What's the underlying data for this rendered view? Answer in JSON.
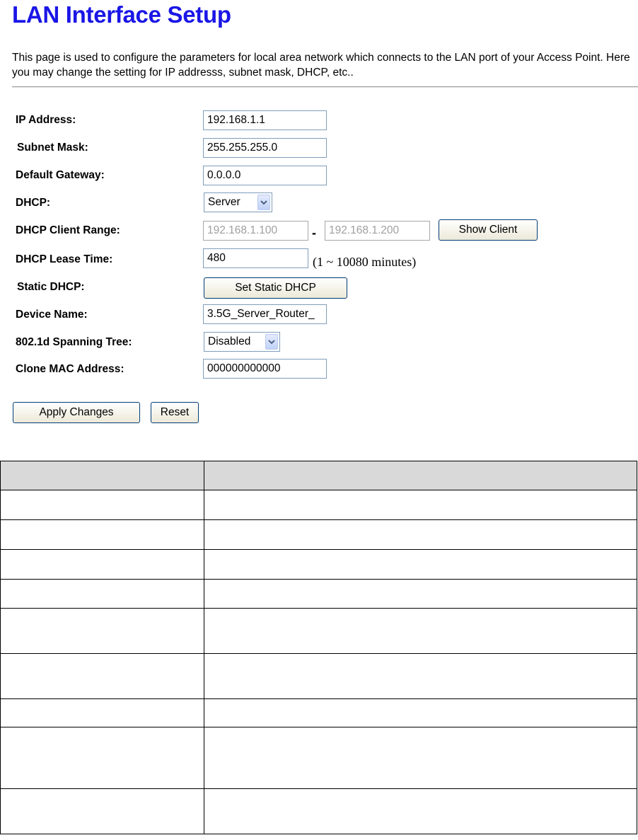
{
  "page": {
    "title": "LAN Interface Setup",
    "description": "This page is used to configure the parameters for local area network which connects to the LAN port of your Access Point. Here you may change the setting for IP addresss, subnet mask, DHCP, etc.."
  },
  "form": {
    "ip_address": {
      "label": "IP Address:",
      "value": "192.168.1.1"
    },
    "subnet_mask": {
      "label": "Subnet Mask:",
      "value": "255.255.255.0"
    },
    "default_gateway": {
      "label": "Default Gateway:",
      "value": "0.0.0.0"
    },
    "dhcp": {
      "label": "DHCP:",
      "selected": "Server"
    },
    "dhcp_client_range": {
      "label": "DHCP Client Range:",
      "start": "192.168.1.100",
      "separator": "-",
      "end": "192.168.1.200",
      "button": "Show Client"
    },
    "dhcp_lease_time": {
      "label": "DHCP Lease Time:",
      "value": "480",
      "hint": "(1 ~ 10080 minutes)"
    },
    "static_dhcp": {
      "label": "Static DHCP:",
      "button": "Set Static DHCP"
    },
    "device_name": {
      "label": "Device Name:",
      "value": "3.5G_Server_Router_"
    },
    "spanning_tree": {
      "label": "802.1d Spanning Tree:",
      "selected": "Disabled"
    },
    "clone_mac": {
      "label": "Clone MAC Address:",
      "value": "000000000000"
    }
  },
  "actions": {
    "apply": "Apply Changes",
    "reset": "Reset"
  },
  "icons": {
    "dropdown": "chevron-down-icon"
  },
  "colors": {
    "title": "#1a16e6",
    "table_header_bg": "#d9d9d9"
  }
}
